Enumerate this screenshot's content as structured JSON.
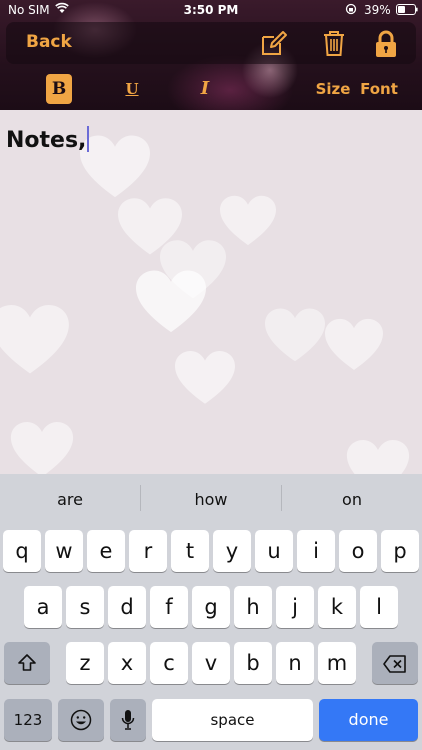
{
  "status_bar": {
    "carrier": "No SIM",
    "time": "3:50 PM",
    "battery": "39%"
  },
  "nav": {
    "back_label": "Back",
    "icons": [
      "edit-icon",
      "trash-icon",
      "lock-icon"
    ]
  },
  "format_toolbar": {
    "bold": "B",
    "underline": "U",
    "italic": "I",
    "size": "Size",
    "font": "Font"
  },
  "note": {
    "text": "Notes,"
  },
  "keyboard": {
    "suggestions": [
      "are",
      "how",
      "on"
    ],
    "row1": [
      "q",
      "w",
      "e",
      "r",
      "t",
      "y",
      "u",
      "i",
      "o",
      "p"
    ],
    "row2": [
      "a",
      "s",
      "d",
      "f",
      "g",
      "h",
      "j",
      "k",
      "l"
    ],
    "row3": [
      "z",
      "x",
      "c",
      "v",
      "b",
      "n",
      "m"
    ],
    "numbers_key": "123",
    "space_key": "space",
    "done_key": "done"
  },
  "colors": {
    "accent": "#f0a544",
    "done_blue": "#3478f6"
  }
}
